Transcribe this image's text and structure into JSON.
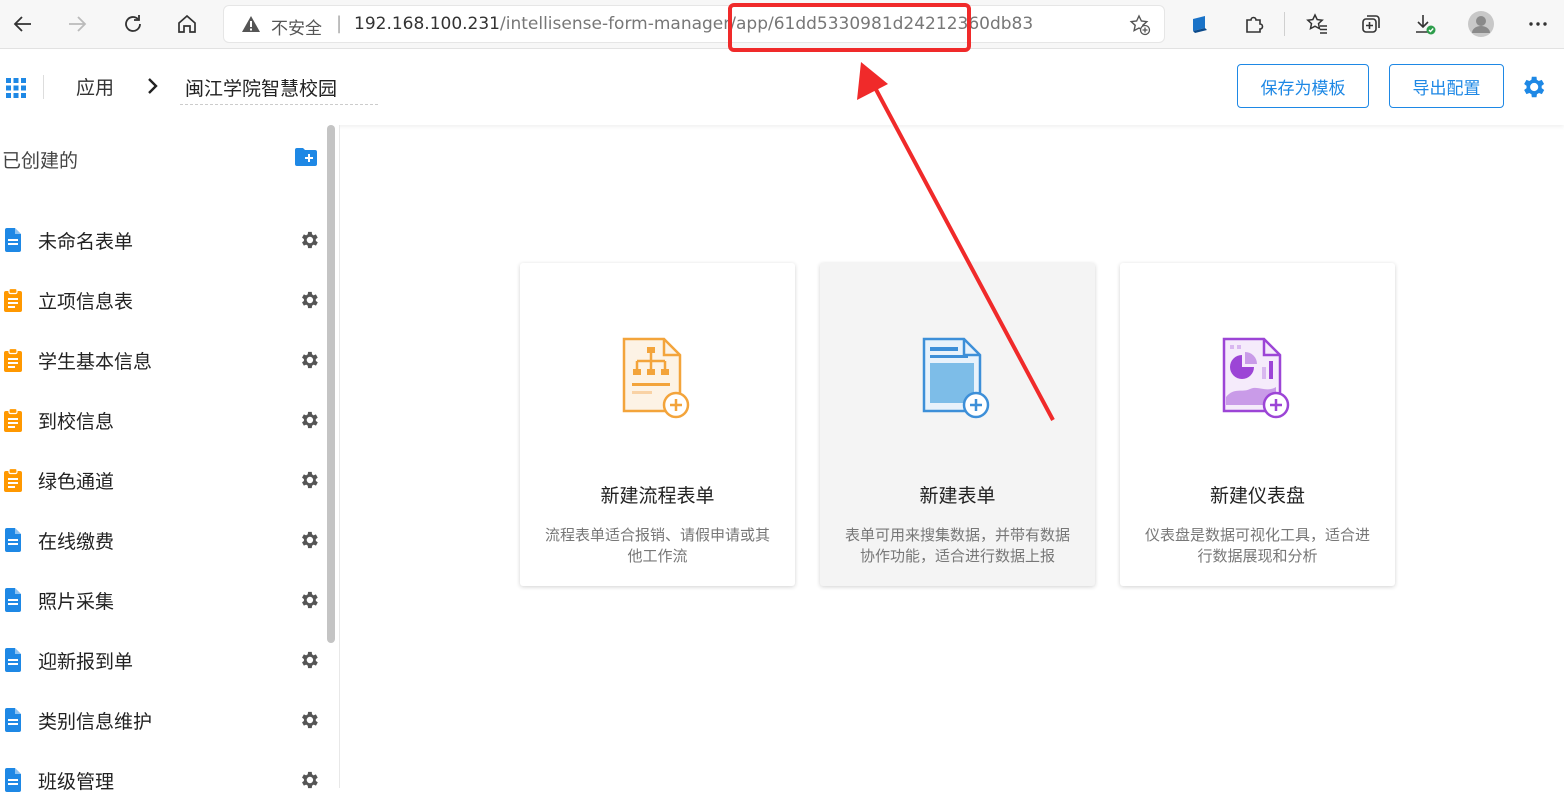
{
  "browser": {
    "insecure_label": "不安全",
    "url_host": "192.168.100.231",
    "url_path": "/intellisense-form-manager/app/61dd5330981d24212360db83"
  },
  "header": {
    "breadcrumb_app": "应用",
    "app_name": "闽江学院智慧校园",
    "save_template_label": "保存为模板",
    "export_config_label": "导出配置"
  },
  "sidebar": {
    "title": "已创建的",
    "items": [
      {
        "label": "未命名表单",
        "icon": "form-doc-icon",
        "color": "#1e88e5"
      },
      {
        "label": "立项信息表",
        "icon": "workflow-form-icon",
        "color": "#ff9800"
      },
      {
        "label": "学生基本信息",
        "icon": "workflow-form-icon",
        "color": "#ff9800"
      },
      {
        "label": "到校信息",
        "icon": "workflow-form-icon",
        "color": "#ff9800"
      },
      {
        "label": "绿色通道",
        "icon": "workflow-form-icon",
        "color": "#ff9800"
      },
      {
        "label": "在线缴费",
        "icon": "form-doc-icon",
        "color": "#1e88e5"
      },
      {
        "label": "照片采集",
        "icon": "form-doc-icon",
        "color": "#1e88e5"
      },
      {
        "label": "迎新报到单",
        "icon": "form-doc-icon",
        "color": "#1e88e5"
      },
      {
        "label": "类别信息维护",
        "icon": "form-doc-icon",
        "color": "#1e88e5"
      },
      {
        "label": "班级管理",
        "icon": "form-doc-icon",
        "color": "#1e88e5"
      }
    ]
  },
  "cards": [
    {
      "title": "新建流程表单",
      "desc": "流程表单适合报销、请假申请或其他工作流",
      "icon": "workflow-form-add-icon",
      "color": "#f3a43b"
    },
    {
      "title": "新建表单",
      "desc": "表单可用来搜集数据，并带有数据协作功能，适合进行数据上报",
      "icon": "form-add-icon",
      "color": "#3d8fd8"
    },
    {
      "title": "新建仪表盘",
      "desc": "仪表盘是数据可视化工具，适合进行数据展现和分析",
      "icon": "dashboard-add-icon",
      "color": "#9c45d6"
    }
  ],
  "colors": {
    "accent": "#1e88e5",
    "annotation": "#f02a2a"
  }
}
